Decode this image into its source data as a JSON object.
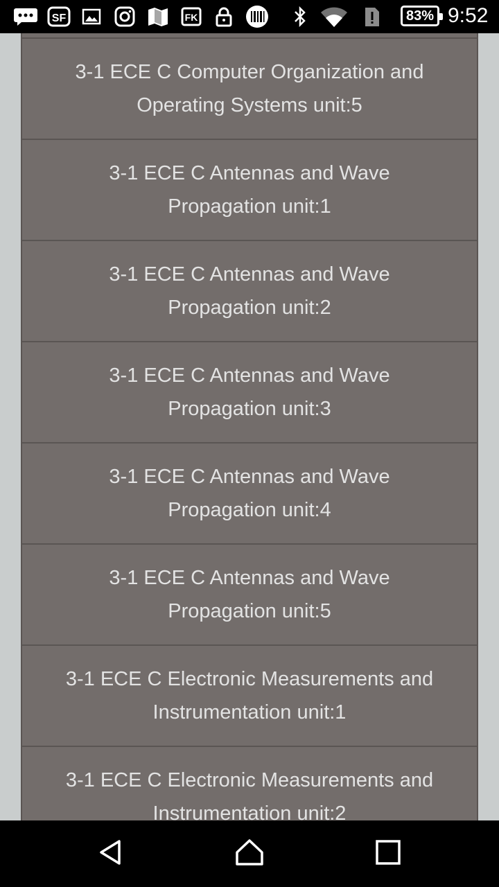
{
  "status_bar": {
    "battery": "83%",
    "time": "9:52",
    "icons": [
      "chat-bubble-icon",
      "sf-app-icon",
      "gallery-icon",
      "instagram-icon",
      "maps-icon",
      "fk-app-icon",
      "lock-icon",
      "barcode-icon",
      "bluetooth-icon",
      "wifi-icon",
      "sim-alert-icon"
    ]
  },
  "list": {
    "items": [
      {
        "line1": "3-1 ECE C Computer Organization and",
        "line2": "Operating Systems unit:5"
      },
      {
        "line1": "3-1 ECE C Antennas and Wave",
        "line2": "Propagation unit:1"
      },
      {
        "line1": "3-1 ECE C Antennas and Wave",
        "line2": "Propagation unit:2"
      },
      {
        "line1": "3-1 ECE C Antennas and Wave",
        "line2": "Propagation unit:3"
      },
      {
        "line1": "3-1 ECE C Antennas and Wave",
        "line2": "Propagation unit:4"
      },
      {
        "line1": "3-1 ECE C Antennas and Wave",
        "line2": "Propagation unit:5"
      },
      {
        "line1": "3-1 ECE C Electronic Measurements and",
        "line2": "Instrumentation unit:1"
      },
      {
        "line1": "3-1 ECE C Electronic Measurements and",
        "line2": "Instrumentation unit:2"
      }
    ]
  },
  "nav_bar": {
    "icons": [
      "back-icon",
      "home-icon",
      "recents-icon"
    ]
  },
  "colors": {
    "list_background": "#736d6b",
    "page_background": "#c9cdcd",
    "item_text": "#e3e3e3"
  }
}
